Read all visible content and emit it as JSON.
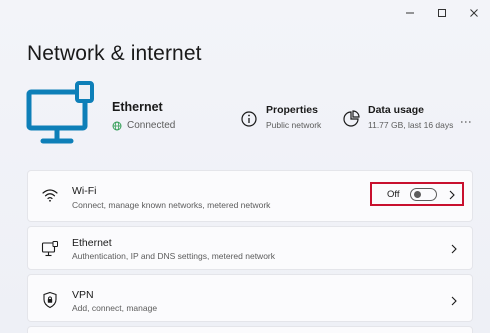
{
  "window": {
    "title": "Network & internet",
    "controls": {
      "minimize_icon": "minimize-icon",
      "maximize_icon": "maximize-icon",
      "close_icon": "close-icon"
    }
  },
  "hero": {
    "device_icon": "monitor-ethernet-icon",
    "device_name": "Ethernet",
    "status_icon": "globe-icon",
    "status": "Connected",
    "properties": {
      "icon": "info-icon",
      "title": "Properties",
      "subtitle": "Public network"
    },
    "data_usage": {
      "icon": "data-usage-icon",
      "title": "Data usage",
      "subtitle": "11.77 GB, last 16 days"
    }
  },
  "settings": [
    {
      "id": "wifi",
      "icon": "wifi-icon",
      "title": "Wi-Fi",
      "description": "Connect, manage known networks, metered network",
      "toggle_label": "Off",
      "toggle_on": false
    },
    {
      "id": "ethernet",
      "icon": "ethernet-icon",
      "title": "Ethernet",
      "description": "Authentication, IP and DNS settings, metered network"
    },
    {
      "id": "vpn",
      "icon": "shield-icon",
      "title": "VPN",
      "description": "Add, connect, manage"
    }
  ],
  "colors": {
    "accent": "#0e7fb8",
    "highlight": "#c8102e",
    "status_green": "#2d9b52"
  }
}
